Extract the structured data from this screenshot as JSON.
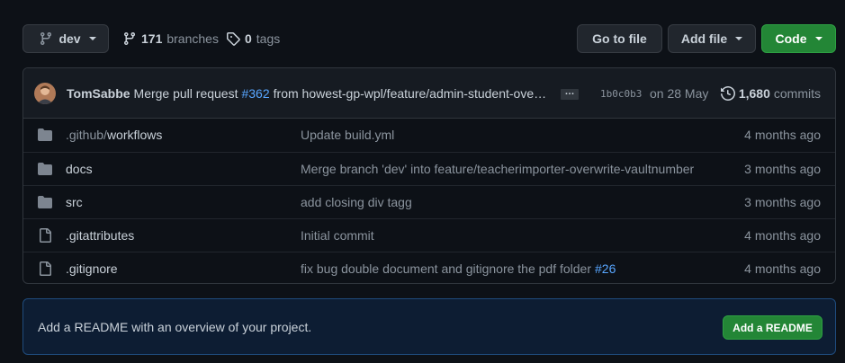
{
  "toolbar": {
    "branch_name": "dev",
    "branches_count": "171",
    "branches_label": "branches",
    "tags_count": "0",
    "tags_label": "tags",
    "goto_file_label": "Go to file",
    "add_file_label": "Add file",
    "code_label": "Code"
  },
  "commit": {
    "author": "TomSabbe",
    "message_prefix": "Merge pull request",
    "pr_link": "#362",
    "message_suffix": "from howest-gp-wpl/feature/admin-student-ove…",
    "ellipsis": "…",
    "sha": "1b0c0b3",
    "date": "on 28 May",
    "commits_count": "1,680",
    "commits_label": "commits"
  },
  "files": [
    {
      "type": "folder",
      "name_prefix": ".github/",
      "name": "workflows",
      "commit": "Update build.yml",
      "pr": "",
      "age": "4 months ago"
    },
    {
      "type": "folder",
      "name_prefix": "",
      "name": "docs",
      "commit": "Merge branch 'dev' into feature/teacherimporter-overwrite-vaultnumber",
      "pr": "",
      "age": "3 months ago"
    },
    {
      "type": "folder",
      "name_prefix": "",
      "name": "src",
      "commit": "add closing div tagg",
      "pr": "",
      "age": "3 months ago"
    },
    {
      "type": "file",
      "name_prefix": "",
      "name": ".gitattributes",
      "commit": "Initial commit",
      "pr": "",
      "age": "4 months ago"
    },
    {
      "type": "file",
      "name_prefix": "",
      "name": ".gitignore",
      "commit": "fix bug double document and gitignore the pdf folder",
      "pr": "#26",
      "age": "4 months ago"
    }
  ],
  "readme": {
    "text": "Add a README with an overview of your project.",
    "button_label": "Add a README"
  },
  "colors": {
    "background": "#0d1117",
    "accent_green": "#238636",
    "link_blue": "#58a6ff",
    "folder_icon": "#7d8590"
  }
}
